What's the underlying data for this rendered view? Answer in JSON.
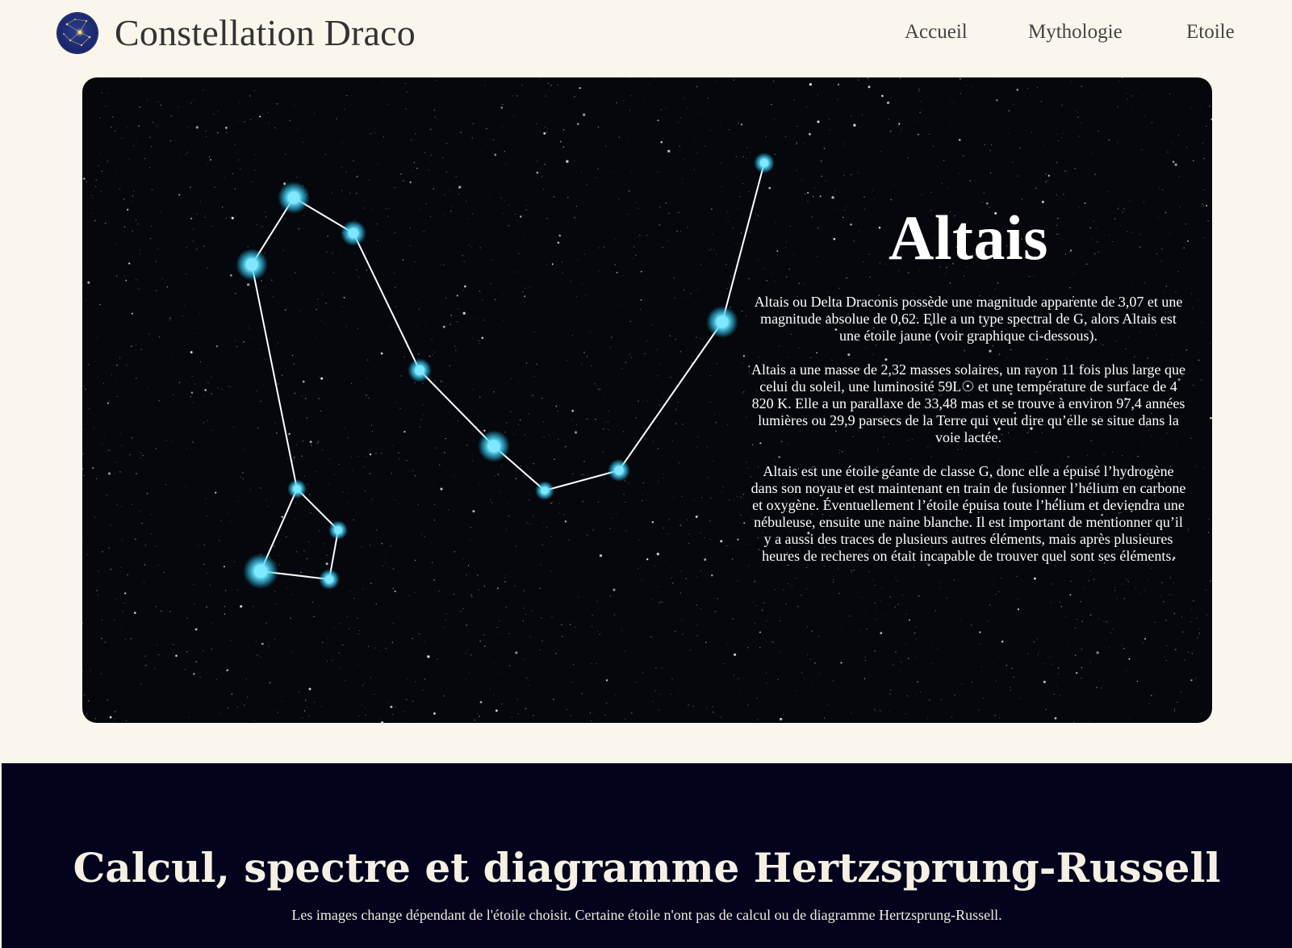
{
  "header": {
    "site_title": "Constellation Draco",
    "logo_icon": "constellation-logo-icon",
    "nav": [
      {
        "label": "Accueil"
      },
      {
        "label": "Mythologie"
      },
      {
        "label": "Etoile"
      }
    ]
  },
  "hero": {
    "star_name": "Altais",
    "paragraphs": [
      "Altais ou Delta Draconis possède une magnitude apparente de 3,07 et une magnitude absolue de 0,62. Elle a un type spectral de G, alors Altais est une étoile jaune (voir graphique ci-dessous).",
      "Altais a une masse de 2,32 masses solaires, un rayon 11 fois plus large que celui du soleil, une luminosité 59L☉ et une température de surface de 4 820 K. Elle a un parallaxe de 33,48 mas et se trouve à environ 97,4 années lumières ou 29,9 parsecs de la Terre qui veut dire qu’elle se situe dans la voie lactée.",
      "Altais est une étoile géante de classe G, donc elle a épuisé l’hydrogène dans son noyau et est maintenant en train de fusionner l’hélium en carbone et oxygène. Éventuellement l’étoile épuisa toute l’hélium et deviendra une nébuleuse, ensuite une naine blanche. Il est important de mentionner qu’il y a aussi des traces de plusieurs autres éléments, mais après plusieures heures de recheres on était incapable de trouver quel sont ses éléments."
    ],
    "colors": {
      "star_glow": "#5fe3ff",
      "line": "#ffffff",
      "sky": "#05070c"
    }
  },
  "calc": {
    "title": "Calcul, spectre et diagramme Hertzsprung-Russell",
    "subtitle": "Les images change dépendant de l'étoile choisit. Certaine étoile n'ont pas de calcul ou de diagramme Hertzsprung-Russell."
  }
}
